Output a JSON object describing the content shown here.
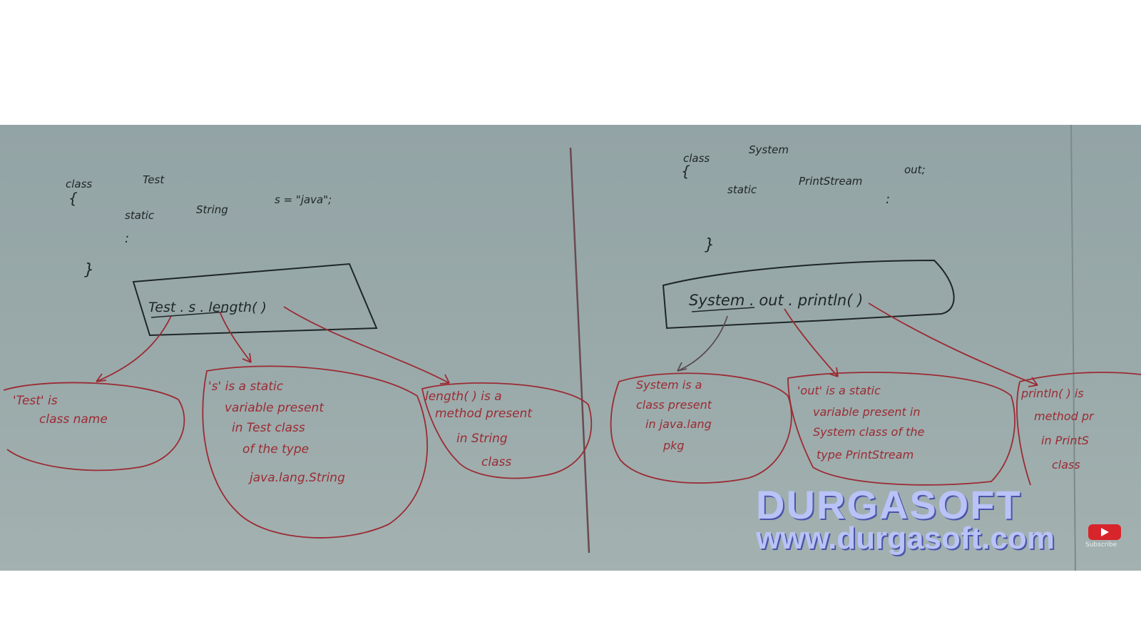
{
  "left_panel": {
    "class_line": [
      "class",
      "Test"
    ],
    "brace_open": "{",
    "field_line": [
      "static",
      "String",
      "s = \"java\";"
    ],
    "dots": ":",
    "brace_close": "}",
    "expression": "Test . s . length( )",
    "notes": [
      [
        "'Test' is",
        "class name"
      ],
      [
        "'s' is a static",
        "variable present",
        "in Test class",
        "of the type",
        "java.lang.String"
      ],
      [
        "length( ) is a",
        "method present",
        "in String",
        "class"
      ]
    ]
  },
  "right_panel": {
    "class_line": [
      "class",
      "System"
    ],
    "brace_open": "{",
    "field_line": [
      "static",
      "PrintStream",
      "out;"
    ],
    "dots": ":",
    "brace_close": "}",
    "expression": "System . out . println( )",
    "notes": [
      [
        "System is a",
        "class present",
        "in java.lang",
        "pkg"
      ],
      [
        "'out' is a static",
        "variable present in",
        "System class of the",
        "type PrintStream"
      ],
      [
        "println( ) is",
        "method pr",
        "in PrintS",
        "class"
      ]
    ]
  },
  "watermark": {
    "brand": "DURGASOFT",
    "url": "www.durgasoft.com",
    "subscribe_label": "Subscribe"
  },
  "colors": {
    "board": "#9aaaaa",
    "marker_black": "#1e2626",
    "marker_red": "#9b2b34",
    "watermark": "#b9c3f7"
  }
}
